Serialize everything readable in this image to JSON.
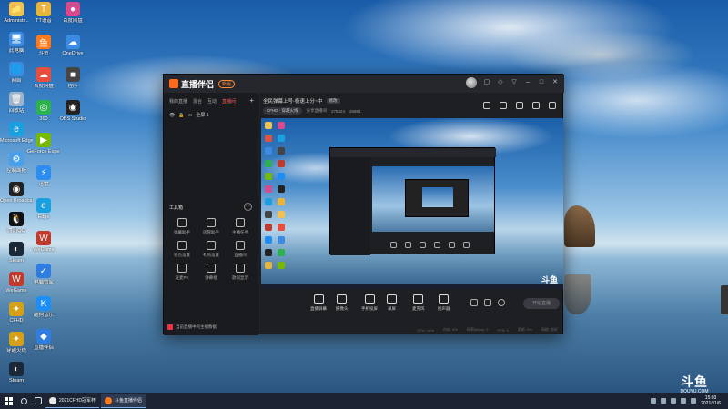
{
  "desktop": {
    "icons": [
      {
        "label": "Administr...",
        "color": "#f2c14e",
        "glyph": "📁"
      },
      {
        "label": "此电脑",
        "color": "#3b8be0",
        "glyph": "🖥"
      },
      {
        "label": "网络",
        "color": "#3b8be0",
        "glyph": "🌐"
      },
      {
        "label": "回收站",
        "color": "#9fb4c8",
        "glyph": "🗑"
      },
      {
        "label": "Microsoft Edge",
        "color": "#1aa0e0",
        "glyph": "e"
      },
      {
        "label": "控制面板",
        "color": "#4aa0e8",
        "glyph": "⚙"
      },
      {
        "label": "Open Broadcast...",
        "color": "#222",
        "glyph": "◉"
      },
      {
        "label": "腾讯QQ",
        "color": "#111",
        "glyph": "🐧"
      },
      {
        "label": "Steam",
        "color": "#1b2838",
        "glyph": "◐"
      },
      {
        "label": "WeGame",
        "color": "#c0392b",
        "glyph": "W"
      },
      {
        "label": "CFHD",
        "color": "#d4a017",
        "glyph": "✦"
      },
      {
        "label": "穿越火线",
        "color": "#d4a017",
        "glyph": "✦"
      },
      {
        "label": "Steam",
        "color": "#1b2838",
        "glyph": "◐"
      }
    ],
    "icons2": [
      {
        "label": "TT语音",
        "color": "#e8b53a",
        "glyph": "T"
      },
      {
        "label": "斗鱼",
        "color": "#ff7a1a",
        "glyph": "鱼"
      },
      {
        "label": "百度网盘",
        "color": "#e94e3c",
        "glyph": "☁"
      },
      {
        "label": "360",
        "color": "#2bb24c",
        "glyph": "◎"
      },
      {
        "label": "GeForce Experience",
        "color": "#76b900",
        "glyph": "▶"
      },
      {
        "label": "迅雷",
        "color": "#2d8cf0",
        "glyph": "⚡"
      },
      {
        "label": "Edge",
        "color": "#1aa0e0",
        "glyph": "e"
      },
      {
        "label": "WeGame",
        "color": "#c0392b",
        "glyph": "W"
      },
      {
        "label": "电脑管家",
        "color": "#2f7de1",
        "glyph": "✓"
      },
      {
        "label": "酷狗音乐",
        "color": "#1c8ef5",
        "glyph": "K"
      },
      {
        "label": "直播伴侣",
        "color": "#2f7de1",
        "glyph": "◆"
      }
    ],
    "icons3": [
      {
        "label": "百度网盘",
        "color": "#d84a8c",
        "glyph": "●"
      },
      {
        "label": "OneDrive",
        "color": "#3b8be0",
        "glyph": "☁"
      },
      {
        "label": "程序",
        "color": "#444",
        "glyph": "■"
      },
      {
        "label": "OBS Studio",
        "color": "#222",
        "glyph": "◉"
      }
    ]
  },
  "app": {
    "title": "直播伴侣",
    "version_badge": "新版",
    "left_tabs": [
      "我的直播",
      "混合",
      "互动",
      "直播间"
    ],
    "active_tab_index": 3,
    "scene_label": "全屏 1",
    "tools_header": "工具箱",
    "tools": [
      {
        "label": "弹幕助手"
      },
      {
        "label": "房管助手"
      },
      {
        "label": "主播任务"
      },
      {
        "label": "钱包设置"
      },
      {
        "label": "礼物设置"
      },
      {
        "label": "直播间"
      },
      {
        "label": "连麦PK"
      },
      {
        "label": "弹幕框"
      },
      {
        "label": "歌词显示"
      }
    ],
    "notice": "当前直播中的主播数据",
    "room_title": "全民弹幕上号-极速上分~中",
    "room_edit": "修改",
    "room_category": "CFHD · 穿越火线",
    "room_meta_1": "分享直播间",
    "room_meta_2": "275324",
    "room_meta_3": "26881",
    "controls": [
      {
        "label": "直播屏幕"
      },
      {
        "label": "摄像头"
      },
      {
        "label": "手机投屏"
      },
      {
        "label": "录屏"
      },
      {
        "label": "麦克风"
      },
      {
        "label": "扬声器"
      }
    ],
    "start_button": "开始直播",
    "status_items": [
      "CPU: 10%",
      "内存: 8%",
      "码率(kbps): 0",
      "FPS: 0",
      "丢帧: 0%",
      "网络: 良好"
    ],
    "watermark": "斗鱼"
  },
  "taskbar": {
    "tasks": [
      {
        "label": "2021CFHD冠军杯",
        "color": "#e8e8e8"
      },
      {
        "label": "斗鱼直播伴侣",
        "color": "#ff7a1a"
      }
    ],
    "time": "15:03",
    "date": "2021/11/6"
  },
  "watermark": {
    "logo": "斗鱼",
    "url": "DOUYU.COM"
  }
}
